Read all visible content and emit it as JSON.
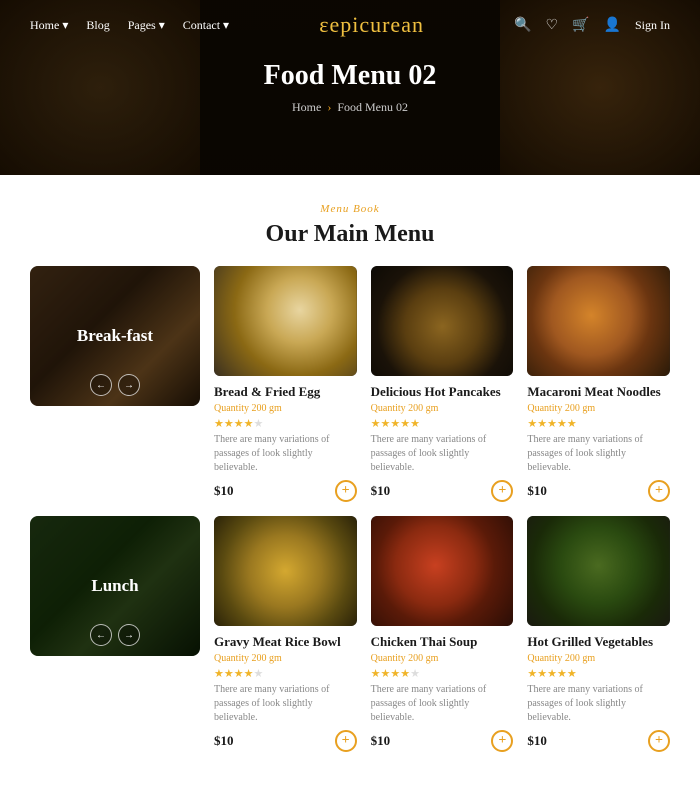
{
  "nav": {
    "logo": "epicurean",
    "logo_prefix": "ε",
    "links": [
      {
        "label": "Home ▾",
        "id": "home"
      },
      {
        "label": "Blog",
        "id": "blog"
      },
      {
        "label": "Pages ▾",
        "id": "pages"
      },
      {
        "label": "Contact ▾",
        "id": "contact"
      }
    ],
    "sign_in": "Sign In"
  },
  "hero": {
    "title": "Food Menu 02",
    "breadcrumb_home": "Home",
    "breadcrumb_current": "Food Menu 02"
  },
  "section": {
    "tag": "Menu Book",
    "title": "Our Main Menu"
  },
  "rows": [
    {
      "category": {
        "name": "Break-fast",
        "img_class": "img-breakfast-cat"
      },
      "items": [
        {
          "name": "Bread & Fried Egg",
          "qty": "Quantity 200 gm",
          "stars": 4,
          "desc": "There are many variations of passages of look slightly believable.",
          "price": "$10",
          "img_class": "img-bread-egg"
        },
        {
          "name": "Delicious Hot Pancakes",
          "qty": "Quantity 200 gm",
          "stars": 5,
          "desc": "There are many variations of passages of look slightly believable.",
          "price": "$10",
          "img_class": "img-pancakes"
        },
        {
          "name": "Macaroni Meat Noodles",
          "qty": "Quantity 200 gm",
          "stars": 5,
          "desc": "There are many variations of passages of look slightly believable.",
          "price": "$10",
          "img_class": "img-mac-noodles"
        }
      ]
    },
    {
      "category": {
        "name": "Lunch",
        "img_class": "img-lunch-cat"
      },
      "items": [
        {
          "name": "Gravy Meat Rice Bowl",
          "qty": "Quantity 200 gm",
          "stars": 4,
          "desc": "There are many variations of passages of look slightly believable.",
          "price": "$10",
          "img_class": "img-rice-bowl"
        },
        {
          "name": "Chicken Thai Soup",
          "qty": "Quantity 200 gm",
          "stars": 4,
          "desc": "There are many variations of passages of look slightly believable.",
          "price": "$10",
          "img_class": "img-thai-soup"
        },
        {
          "name": "Hot Grilled Vegetables",
          "qty": "Quantity 200 gm",
          "stars": 5,
          "desc": "There are many variations of passages of look slightly believable.",
          "price": "$10",
          "img_class": "img-grilled-veg"
        }
      ]
    }
  ],
  "prev_arrow": "←",
  "next_arrow": "→",
  "add_icon": "+"
}
